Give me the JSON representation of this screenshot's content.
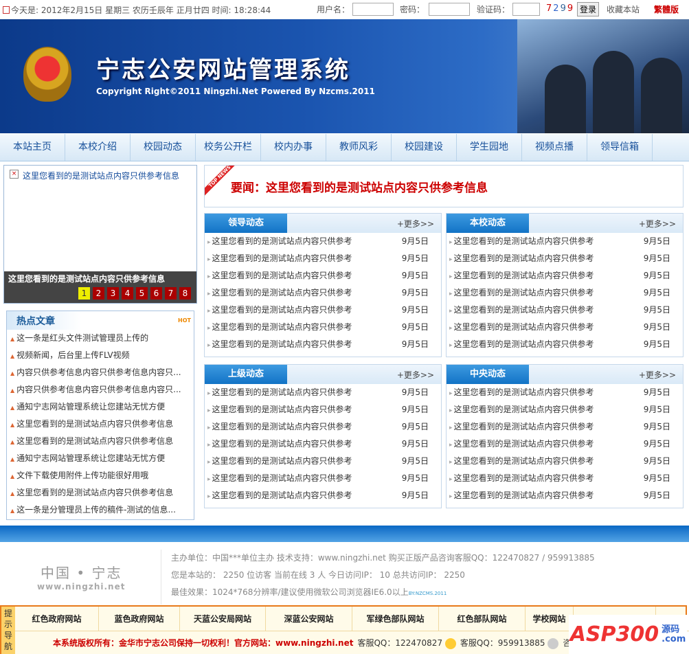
{
  "topbar": {
    "date_text": "今天是: 2012年2月15日  星期三  农历壬辰年  正月廿四  时间: 18:28:44",
    "username_label": "用户名：",
    "password_label": "密码：",
    "captcha_label": "验证码：",
    "captcha_digits": [
      "7",
      "2",
      "9",
      "9"
    ],
    "login_label": "登录",
    "bookmark_label": "收藏本站",
    "traditional_label": "繁體版"
  },
  "banner": {
    "title": "宁志公安网站管理系统",
    "copyright": "Copyright Right©2011 Ningzhi.Net Powered By Nzcms.2011"
  },
  "nav": [
    "本站主页",
    "本校介绍",
    "校园动态",
    "校务公开栏",
    "校内办事",
    "教师风彩",
    "校园建设",
    "学生园地",
    "视频点播",
    "领导信箱"
  ],
  "slideshow": {
    "image_alt": "这里您看到的是测试站点内容只供参考信息",
    "caption": "这里您看到的是测试站点内容只供参考信息",
    "pages": [
      "1",
      "2",
      "3",
      "4",
      "5",
      "6",
      "7",
      "8"
    ],
    "active_page": 1
  },
  "hot": {
    "title": "热点文章",
    "badge": "HOT",
    "items": [
      "这一条是红头文件测试管理员上传的",
      "视频新闻，后台里上传FLV视频",
      "内容只供参考信息内容只供参考信息内容只...",
      "内容只供参考信息内容只供参考信息内容只...",
      "通知宁志网站管理系统让您建站无忧方便",
      "这里您看到的是测试站点内容只供参考信息",
      "这里您看到的是测试站点内容只供参考信息",
      "通知宁志网站管理系统让您建站无忧方便",
      "文件下载使用附件上传功能很好用哦",
      "这里您看到的是测试站点内容只供参考信息",
      "这一条是分管理员上传的稿件-测试的信息..."
    ]
  },
  "headline": {
    "ribbon": "TOP NEWS",
    "text": "要闻：这里您看到的是测试站点内容只供参考信息"
  },
  "more_label": "+更多>>",
  "boxes": [
    {
      "title": "领导动态",
      "items": [
        [
          "这里您看到的是测试站点内容只供参考",
          "9月5日"
        ],
        [
          "这里您看到的是测试站点内容只供参考",
          "9月5日"
        ],
        [
          "这里您看到的是测试站点内容只供参考",
          "9月5日"
        ],
        [
          "这里您看到的是测试站点内容只供参考",
          "9月5日"
        ],
        [
          "这里您看到的是测试站点内容只供参考",
          "9月5日"
        ],
        [
          "这里您看到的是测试站点内容只供参考",
          "9月5日"
        ],
        [
          "这里您看到的是测试站点内容只供参考",
          "9月5日"
        ]
      ]
    },
    {
      "title": "本校动态",
      "items": [
        [
          "这里您看到的是测试站点内容只供参考",
          "9月5日"
        ],
        [
          "这里您看到的是测试站点内容只供参考",
          "9月5日"
        ],
        [
          "这里您看到的是测试站点内容只供参考",
          "9月5日"
        ],
        [
          "这里您看到的是测试站点内容只供参考",
          "9月5日"
        ],
        [
          "这里您看到的是测试站点内容只供参考",
          "9月5日"
        ],
        [
          "这里您看到的是测试站点内容只供参考",
          "9月5日"
        ],
        [
          "这里您看到的是测试站点内容只供参考",
          "9月5日"
        ]
      ]
    },
    {
      "title": "上级动态",
      "items": [
        [
          "这里您看到的是测试站点内容只供参考",
          "9月5日"
        ],
        [
          "这里您看到的是测试站点内容只供参考",
          "9月5日"
        ],
        [
          "这里您看到的是测试站点内容只供参考",
          "9月5日"
        ],
        [
          "这里您看到的是测试站点内容只供参考",
          "9月5日"
        ],
        [
          "这里您看到的是测试站点内容只供参考",
          "9月5日"
        ],
        [
          "这里您看到的是测试站点内容只供参考",
          "9月5日"
        ],
        [
          "这里您看到的是测试站点内容只供参考",
          "9月5日"
        ]
      ]
    },
    {
      "title": "中央动态",
      "items": [
        [
          "这里您看到的是测试站点内容只供参考",
          "9月5日"
        ],
        [
          "这里您看到的是测试站点内容只供参考",
          "9月5日"
        ],
        [
          "这里您看到的是测试站点内容只供参考",
          "9月5日"
        ],
        [
          "这里您看到的是测试站点内容只供参考",
          "9月5日"
        ],
        [
          "这里您看到的是测试站点内容只供参考",
          "9月5日"
        ],
        [
          "这里您看到的是测试站点内容只供参考",
          "9月5日"
        ],
        [
          "这里您看到的是测试站点内容只供参考",
          "9月5日"
        ]
      ]
    }
  ],
  "footer": {
    "logo_cn": "中国 • 宁志",
    "logo_url": "www.ningzhi.net",
    "line1": "主办单位：中国***单位主办   技术支持：www.ningzhi.net   购买正版产品咨询客服QQ：122470827 / 959913885",
    "line2": "您是本站的： 2250 位访客  当前在线 3 人  今日访问IP： 10  总共访问IP： 2250",
    "line3": "最佳效果：1024*768分辨率/建议使用微软公司浏览器IE6.0以上",
    "by": "BY:NZCMS.2011"
  },
  "bottom": {
    "tip": "提示导航",
    "links": [
      "红色政府网站",
      "蓝色政府网站",
      "天蓝公安局网站",
      "深蓝公安网站",
      "军绿色部队网站",
      "红色部队网站",
      "学校网站",
      "",
      ""
    ],
    "rights": "本系统版权所有：金华市宁志公司保持一切权利！官方网站：www.ningzhi.net",
    "qq1": "客服QQ：122470827",
    "qq2": "客服QQ：959913885",
    "consult": "咨询"
  },
  "watermark": {
    "text": "ASP300",
    "sub": "源码 .com"
  }
}
